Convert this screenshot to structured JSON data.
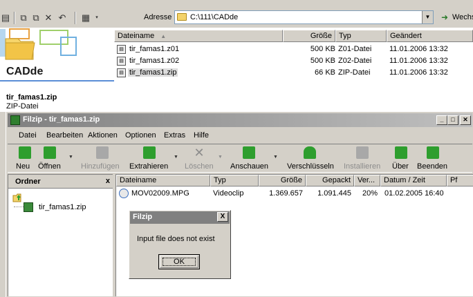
{
  "explorer": {
    "address_label": "Adresse",
    "address_value": "C:\\111\\CADde",
    "go_label": "Wechs",
    "panel_title": "CADde",
    "selected_name": "tir_famas1.zip",
    "selected_type": "ZIP-Datei",
    "columns": [
      "Dateiname",
      "Größe",
      "Typ",
      "Geändert"
    ],
    "files": [
      {
        "name": "tir_famas1.z01",
        "size": "500 KB",
        "type": "Z01-Datei",
        "modified": "11.01.2006 13:32"
      },
      {
        "name": "tir_famas1.z02",
        "size": "500 KB",
        "type": "Z02-Datei",
        "modified": "11.01.2006 13:32"
      },
      {
        "name": "tir_famas1.zip",
        "size": "66 KB",
        "type": "ZIP-Datei",
        "modified": "11.01.2006 13:32"
      }
    ]
  },
  "filzip": {
    "title": "Filzip - tir_famas1.zip",
    "menu": [
      "Datei",
      "Bearbeiten",
      "Aktionen",
      "Optionen",
      "Extras",
      "Hilfe"
    ],
    "toolbar": [
      {
        "label": "Neu",
        "color": "#2e9e2e"
      },
      {
        "label": "Öffnen",
        "color": "#2e9e2e"
      },
      {
        "label": "Hinzufügen",
        "color": "#a0a0a0"
      },
      {
        "label": "Extrahieren",
        "color": "#2e9e2e"
      },
      {
        "label": "Löschen",
        "color": "#a0a0a0"
      },
      {
        "label": "Anschauen",
        "color": "#2e9e2e"
      },
      {
        "label": "Verschlüsseln",
        "color": "#2e9e2e"
      },
      {
        "label": "Installieren",
        "color": "#a0a0a0"
      },
      {
        "label": "Über",
        "color": "#2e9e2e"
      },
      {
        "label": "Beenden",
        "color": "#2e9e2e"
      }
    ],
    "folder_panel_title": "Ordner",
    "folder_panel_close": "x",
    "tree_item": "tir_famas1.zip",
    "columns": [
      "Dateiname",
      "Typ",
      "Größe",
      "Gepackt",
      "Ver...",
      "Datum / Zeit",
      "Pf"
    ],
    "rows": [
      {
        "name": "MOV02009.MPG",
        "type": "Videoclip",
        "size": "1.369.657",
        "packed": "1.091.445",
        "ratio": "20%",
        "date": "01.02.2005  16:40"
      }
    ]
  },
  "dialog": {
    "title": "Filzip",
    "close": "X",
    "message": "Input file does not exist",
    "ok_label": "OK"
  }
}
